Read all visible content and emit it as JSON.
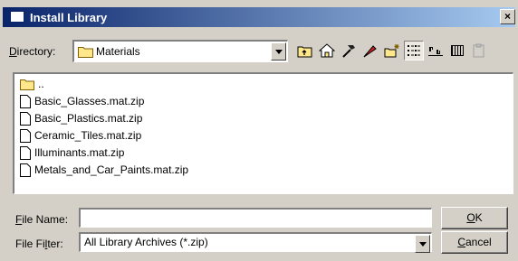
{
  "window": {
    "title": "Install Library",
    "close_label": "×"
  },
  "directory": {
    "label_pre": "",
    "label_under": "D",
    "label_post": "irectory:",
    "value": "Materials"
  },
  "toolbar": {
    "buttons": [
      {
        "name": "up-folder-icon"
      },
      {
        "name": "home-icon"
      },
      {
        "name": "hammer-icon"
      },
      {
        "name": "bookmark-icon"
      },
      {
        "name": "new-folder-icon"
      },
      {
        "name": "list-view-icon",
        "active": true
      },
      {
        "name": "sort-icon"
      },
      {
        "name": "detail-view-icon"
      },
      {
        "name": "clipboard-icon"
      }
    ]
  },
  "filelist": {
    "items": [
      {
        "type": "folder",
        "label": ".."
      },
      {
        "type": "file",
        "label": "Basic_Glasses.mat.zip"
      },
      {
        "type": "file",
        "label": "Basic_Plastics.mat.zip"
      },
      {
        "type": "file",
        "label": "Ceramic_Tiles.mat.zip"
      },
      {
        "type": "file",
        "label": "Illuminants.mat.zip"
      },
      {
        "type": "file",
        "label": "Metals_and_Car_Paints.mat.zip"
      }
    ]
  },
  "file_name": {
    "label_under": "F",
    "label_post": "ile Name:",
    "value": ""
  },
  "file_filter": {
    "label_pre": "File Fi",
    "label_under": "l",
    "label_post": "ter:",
    "value": "All Library Archives (*.zip)"
  },
  "ok_button": {
    "label_under": "O",
    "label_post": "K"
  },
  "cancel_button": {
    "label_under": "C",
    "label_post": "ancel"
  }
}
